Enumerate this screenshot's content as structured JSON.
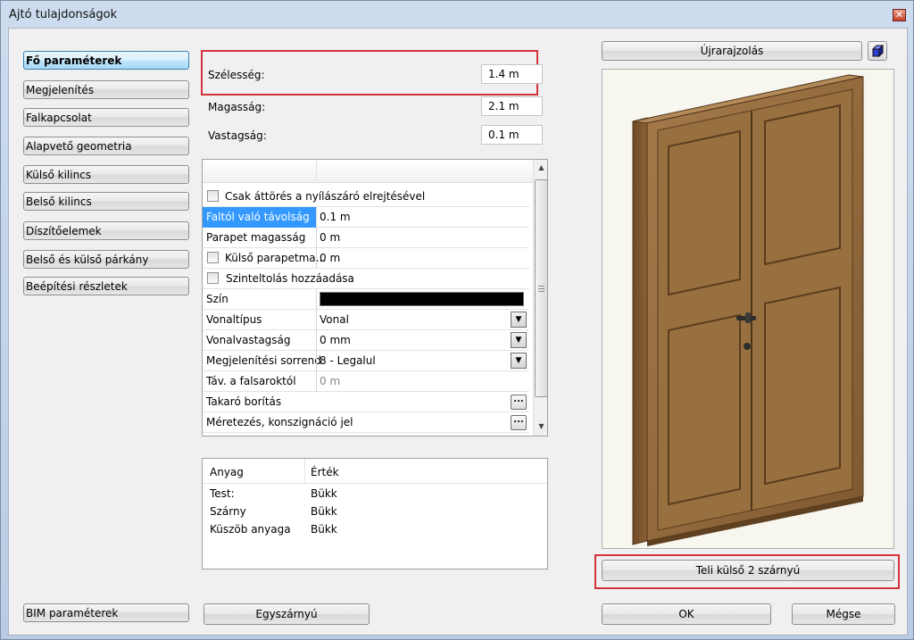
{
  "window": {
    "title": "Ajtó tulajdonságok",
    "close_glyph": "✕"
  },
  "sidebar": {
    "items": [
      {
        "label": "Fő paraméterek",
        "active": true
      },
      {
        "label": "Megjelenítés"
      },
      {
        "label": "Falkapcsolat"
      },
      {
        "label": "Alapvető geometria"
      },
      {
        "label": "Külső kilincs"
      },
      {
        "label": "Belső kilincs"
      },
      {
        "label": "Díszítőelemek"
      },
      {
        "label": "Belső és külső párkány"
      },
      {
        "label": "Beépítési részletek"
      }
    ],
    "bim_label": "BIM paraméterek"
  },
  "params": {
    "width_label": "Szélesség:",
    "width_value": "1.4 m",
    "height_label": "Magasság:",
    "height_value": "2.1 m",
    "thickness_label": "Vastagság:",
    "thickness_value": "0.1 m"
  },
  "property_grid": {
    "rows": [
      {
        "key": "Csak áttörés a nyílászáró elrejtésével"
      },
      {
        "key": "Faltól való távolság",
        "value": "0.1 m"
      },
      {
        "key": "Parapet magasság",
        "value": "0 m"
      },
      {
        "key": "Külső parapetma...",
        "value": "0 m"
      },
      {
        "key": "Szinteltolás hozzáadása"
      },
      {
        "key": "Szín"
      },
      {
        "key": "Vonaltípus",
        "value": "Vonal"
      },
      {
        "key": "Vonalvastagság",
        "value": "0 mm"
      },
      {
        "key": "Megjelenítési sorrend",
        "value": "8 - Legalul"
      },
      {
        "key": "Táv. a falsaroktól",
        "value": "0 m"
      },
      {
        "key": "Takaró borítás"
      },
      {
        "key": "Méretezés, konszignáció jel"
      }
    ],
    "color_value": "#000000",
    "ellipsis": "...",
    "dropdown_glyph": "▼",
    "scroll_up": "▲",
    "scroll_down": "▼"
  },
  "materials": {
    "headers": [
      "Anyag",
      "Érték"
    ],
    "rows": [
      {
        "name": "Test:",
        "value": "Bükk"
      },
      {
        "name": "Szárny",
        "value": "Bükk"
      },
      {
        "name": "Küszöb anyaga",
        "value": "Bükk"
      }
    ]
  },
  "buttons": {
    "redraw": "Újrarajzolás",
    "single_leaf": "Egyszárnyú",
    "door_type": "Teli külső 2 szárnyú",
    "ok": "OK",
    "cancel": "Mégse"
  },
  "colors": {
    "highlight_red": "#d6323b",
    "selection_blue": "#3399ff",
    "door_wood": "#8a6238"
  }
}
